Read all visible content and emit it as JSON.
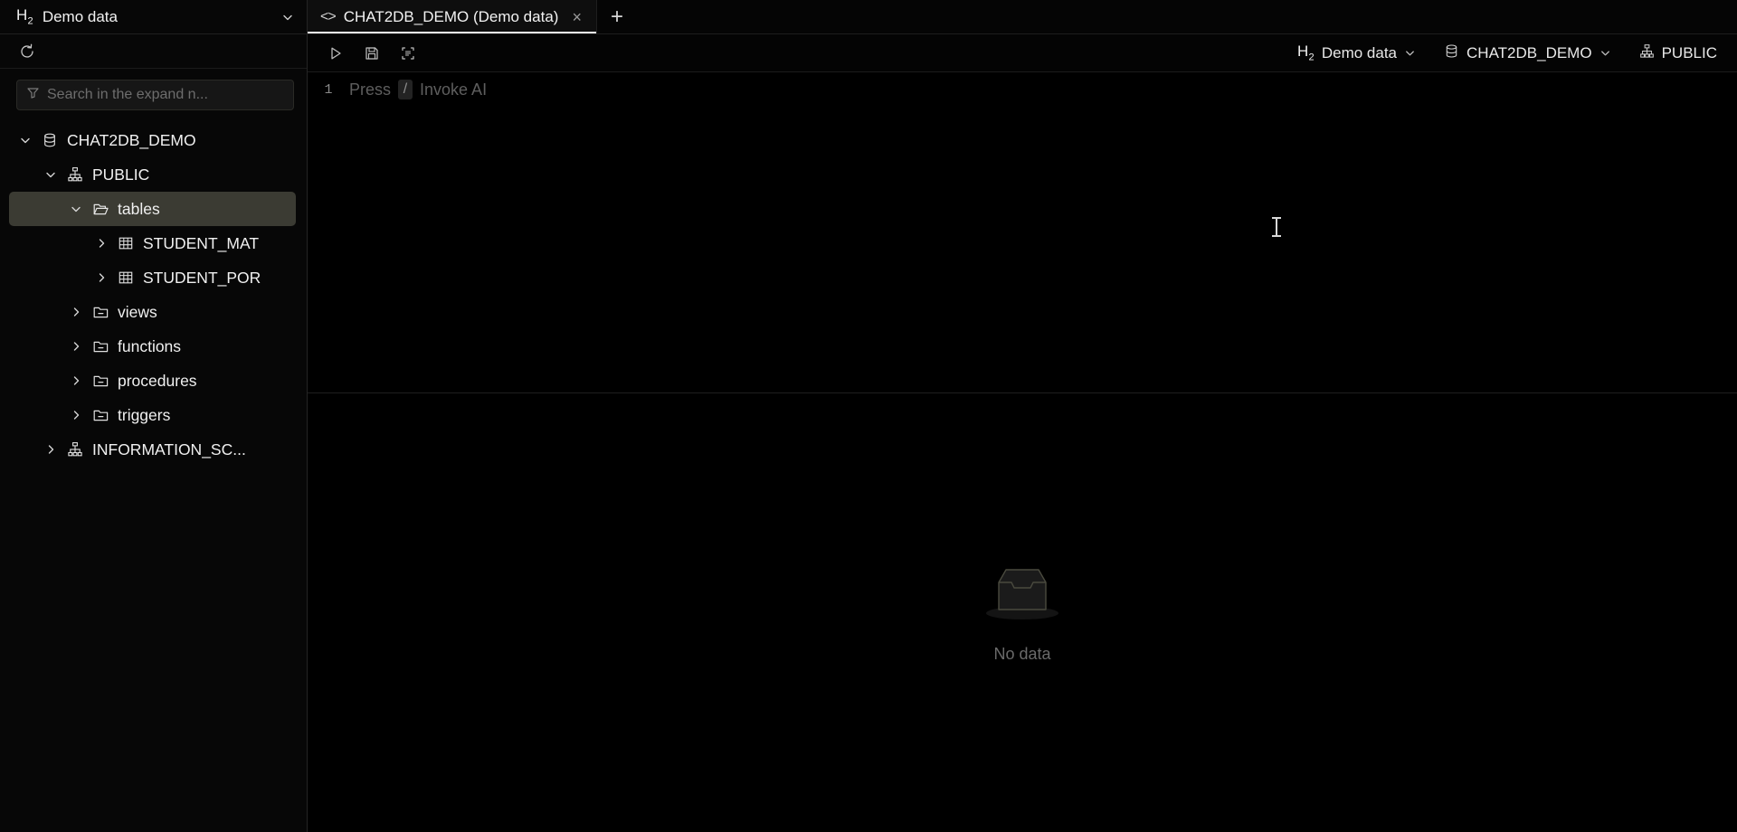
{
  "sidebar": {
    "connection": {
      "engine_badge": "H",
      "engine_sub": "2",
      "name": "Demo data",
      "dropdown_icon": "chevron-down-icon"
    },
    "refresh_icon": "refresh-icon",
    "search": {
      "placeholder": "Search in the expand n...",
      "value": "",
      "icon": "filter-icon"
    },
    "tree": [
      {
        "label": "CHAT2DB_DEMO",
        "depth": 0,
        "icon": "database-icon",
        "caret": "down",
        "selected": false
      },
      {
        "label": "PUBLIC",
        "depth": 1,
        "icon": "schema-icon",
        "caret": "down",
        "selected": false
      },
      {
        "label": "tables",
        "depth": 2,
        "icon": "folder-open-icon",
        "caret": "down",
        "selected": true
      },
      {
        "label": "STUDENT_MAT",
        "depth": 3,
        "icon": "table-icon",
        "caret": "right",
        "selected": false
      },
      {
        "label": "STUDENT_POR",
        "depth": 3,
        "icon": "table-icon",
        "caret": "right",
        "selected": false
      },
      {
        "label": "views",
        "depth": 2,
        "icon": "folder-dash-icon",
        "caret": "right",
        "selected": false
      },
      {
        "label": "functions",
        "depth": 2,
        "icon": "folder-dash-icon",
        "caret": "right",
        "selected": false
      },
      {
        "label": "procedures",
        "depth": 2,
        "icon": "folder-dash-icon",
        "caret": "right",
        "selected": false
      },
      {
        "label": "triggers",
        "depth": 2,
        "icon": "folder-dash-icon",
        "caret": "right",
        "selected": false
      },
      {
        "label": "INFORMATION_SC...",
        "depth": 1,
        "icon": "schema-icon",
        "caret": "right",
        "selected": false
      }
    ]
  },
  "main": {
    "tabs": [
      {
        "label": "CHAT2DB_DEMO (Demo data)",
        "icon": "code-icon",
        "close": "×",
        "active": true
      }
    ],
    "add_tab_label": "+",
    "toolbar": {
      "execute_icon": "play-icon",
      "save_icon": "save-icon",
      "format_icon": "format-sql-icon",
      "selectors": [
        {
          "icon": "h2-icon",
          "label": "Demo data",
          "caret": "chevron-down-icon"
        },
        {
          "icon": "database-icon",
          "label": "CHAT2DB_DEMO",
          "caret": "chevron-down-icon"
        },
        {
          "icon": "schema-icon",
          "label": "PUBLIC",
          "caret": "chevron-down-icon"
        }
      ]
    },
    "editor": {
      "line_number": "1",
      "hint_prefix": "Press",
      "hint_key": "/",
      "hint_suffix": "Invoke AI",
      "content": ""
    },
    "results": {
      "empty_icon": "inbox-icon",
      "empty_text": "No data"
    }
  },
  "colors": {
    "background": "#000000",
    "panel": "#070707",
    "selection": "#3b3b33",
    "border": "#242424",
    "text": "#f0f0f0",
    "muted": "#6a6a6a"
  }
}
